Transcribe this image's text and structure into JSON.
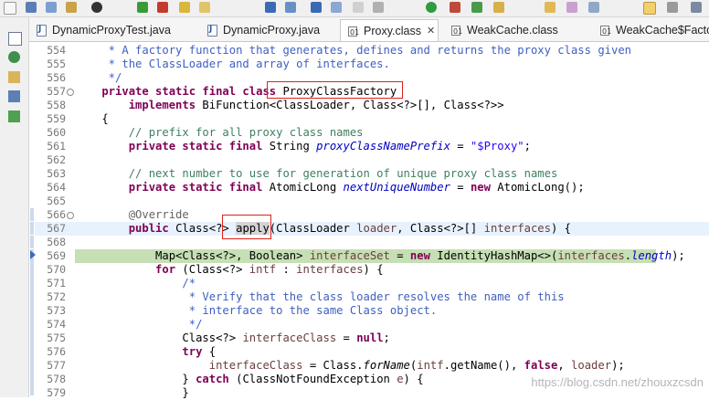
{
  "editor": {
    "tabs": [
      {
        "label": "DynamicProxyTest.java",
        "kind": "java",
        "active": false,
        "closable": false
      },
      {
        "label": "DynamicProxy.java",
        "kind": "java",
        "active": false,
        "closable": false
      },
      {
        "label": "Proxy.class",
        "kind": "class",
        "active": true,
        "closable": true
      },
      {
        "label": "WeakCache.class",
        "kind": "class",
        "active": false,
        "closable": false
      },
      {
        "label": "WeakCache$Factory.c",
        "kind": "class",
        "active": false,
        "closable": false
      }
    ],
    "close_glyph": "✕",
    "lines": [
      {
        "n": "554",
        "t": [
          [
            "cm",
            "     * A factory function that generates, defines and returns the proxy class given"
          ]
        ]
      },
      {
        "n": "555",
        "t": [
          [
            "cm",
            "     * the ClassLoader and array of interfaces."
          ]
        ]
      },
      {
        "n": "556",
        "t": [
          [
            "cm",
            "     */"
          ]
        ]
      },
      {
        "n": "557",
        "fold": true,
        "t": [
          [
            "kw",
            "    private static final class"
          ],
          [
            "",
            " ProxyClassFactory"
          ]
        ]
      },
      {
        "n": "558",
        "t": [
          [
            "kw",
            "        implements"
          ],
          [
            "",
            " BiFunction<ClassLoader, Class<?>[], Class<?>>"
          ]
        ]
      },
      {
        "n": "559",
        "t": [
          [
            "",
            "    {"
          ]
        ]
      },
      {
        "n": "560",
        "t": [
          [
            "lc",
            "        // prefix for all proxy class names"
          ]
        ]
      },
      {
        "n": "561",
        "t": [
          [
            "kw",
            "        private static final"
          ],
          [
            "",
            " String "
          ],
          [
            "fld",
            "proxyClassNamePrefix"
          ],
          [
            "",
            " = "
          ],
          [
            "str",
            "\"$Proxy\""
          ],
          [
            "",
            ";"
          ]
        ]
      },
      {
        "n": "562",
        "t": []
      },
      {
        "n": "563",
        "t": [
          [
            "lc",
            "        // next number to use for generation of unique proxy class names"
          ]
        ]
      },
      {
        "n": "564",
        "t": [
          [
            "kw",
            "        private static final"
          ],
          [
            "",
            " AtomicLong "
          ],
          [
            "fld",
            "nextUniqueNumber"
          ],
          [
            "",
            " = "
          ],
          [
            "kw",
            "new"
          ],
          [
            "",
            " AtomicLong();"
          ]
        ]
      },
      {
        "n": "565",
        "t": []
      },
      {
        "n": "566",
        "fold": true,
        "t": [
          [
            "ann",
            "        @Override"
          ]
        ]
      },
      {
        "n": "567",
        "cur": true,
        "t": [
          [
            "kw",
            "        public"
          ],
          [
            "",
            " Class<?> "
          ],
          [
            "occ",
            "apply"
          ],
          [
            "",
            "(ClassLoader "
          ],
          [
            "var",
            "loader"
          ],
          [
            "",
            ", Class<?>[] "
          ],
          [
            "var",
            "interfaces"
          ],
          [
            "",
            ") {"
          ]
        ]
      },
      {
        "n": "568",
        "t": []
      },
      {
        "n": "569",
        "dbg": true,
        "t": [
          [
            "",
            "            Map<Class<?>, Boolean> "
          ],
          [
            "var",
            "interfaceSet"
          ],
          [
            "",
            " = "
          ],
          [
            "kw",
            "new"
          ],
          [
            "",
            " IdentityHashMap<>("
          ],
          [
            "var",
            "interfaces"
          ],
          [
            "",
            "."
          ],
          [
            "fld",
            "length"
          ],
          [
            "",
            ");"
          ]
        ]
      },
      {
        "n": "570",
        "t": [
          [
            "kw",
            "            for"
          ],
          [
            "",
            " (Class<?> "
          ],
          [
            "var",
            "intf"
          ],
          [
            "",
            " : "
          ],
          [
            "var",
            "interfaces"
          ],
          [
            "",
            ") {"
          ]
        ]
      },
      {
        "n": "571",
        "t": [
          [
            "cm",
            "                /*"
          ]
        ]
      },
      {
        "n": "572",
        "t": [
          [
            "cm",
            "                 * Verify that the class loader resolves the name of this"
          ]
        ]
      },
      {
        "n": "573",
        "t": [
          [
            "cm",
            "                 * interface to the same Class object."
          ]
        ]
      },
      {
        "n": "574",
        "t": [
          [
            "cm",
            "                 */"
          ]
        ]
      },
      {
        "n": "575",
        "t": [
          [
            "",
            "                Class<?> "
          ],
          [
            "var",
            "interfaceClass"
          ],
          [
            "",
            " = "
          ],
          [
            "kw",
            "null"
          ],
          [
            "",
            ";"
          ]
        ]
      },
      {
        "n": "576",
        "t": [
          [
            "kw",
            "                try"
          ],
          [
            "",
            " {"
          ]
        ]
      },
      {
        "n": "577",
        "t": [
          [
            "",
            "                    "
          ],
          [
            "var",
            "interfaceClass"
          ],
          [
            "",
            " = Class."
          ],
          [
            "fm",
            "forName"
          ],
          [
            "",
            "("
          ],
          [
            "var",
            "intf"
          ],
          [
            "",
            ".getName(), "
          ],
          [
            "kw",
            "false"
          ],
          [
            "",
            ", "
          ],
          [
            "var",
            "loader"
          ],
          [
            "",
            ");"
          ]
        ]
      },
      {
        "n": "578",
        "t": [
          [
            "",
            "                } "
          ],
          [
            "kw",
            "catch"
          ],
          [
            "",
            " (ClassNotFoundException "
          ],
          [
            "var",
            "e"
          ],
          [
            "",
            ") {"
          ]
        ]
      },
      {
        "n": "579",
        "t": [
          [
            "",
            "                }"
          ]
        ]
      }
    ]
  },
  "watermark": "https://blog.csdn.net/zhouxzcsdn",
  "colors": {
    "keyword": "#7f0055",
    "javadoc": "#3f5fbf",
    "line_comment": "#3f7f5f",
    "field": "#0000c0",
    "string": "#2a00ff",
    "annotation": "#646464",
    "debug_line": "#c6dfb4",
    "highlight_box": "#e0201a"
  },
  "icons": {
    "toolbar": [
      "new-file-icon",
      "save-icon",
      "run-icon",
      "debug-icon",
      "stop-icon",
      "search-icon",
      "open-type-icon"
    ],
    "sidebar": [
      "hierarchy-icon",
      "bug-icon",
      "package-icon",
      "outline-icon",
      "grid-icon"
    ]
  }
}
